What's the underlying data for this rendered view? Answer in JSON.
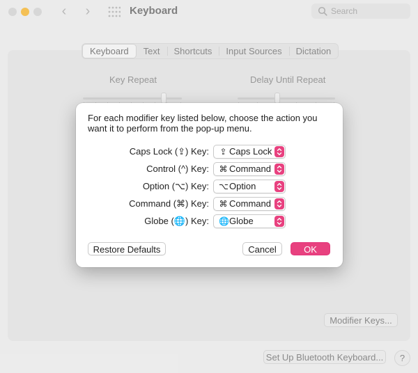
{
  "window": {
    "title": "Keyboard",
    "search_placeholder": "Search"
  },
  "tabs": [
    {
      "label": "Keyboard",
      "selected": true
    },
    {
      "label": "Text",
      "selected": false
    },
    {
      "label": "Shortcuts",
      "selected": false
    },
    {
      "label": "Input Sources",
      "selected": false
    },
    {
      "label": "Dictation",
      "selected": false
    }
  ],
  "sliders": {
    "key_repeat_label": "Key Repeat",
    "delay_label": "Delay Until Repeat"
  },
  "panel": {
    "modifier_keys_button": "Modifier Keys...",
    "bluetooth_button": "Set Up Bluetooth Keyboard...",
    "help_button": "?"
  },
  "dialog": {
    "message": "For each modifier key listed below, choose the action you want it to perform from the pop-up menu.",
    "rows": [
      {
        "label": "Caps Lock (⇪) Key:",
        "glyph": "⇪",
        "value": "Caps Lock"
      },
      {
        "label": "Control (^) Key:",
        "glyph": "⌘",
        "value": "Command"
      },
      {
        "label": "Option (⌥) Key:",
        "glyph": "⌥",
        "value": "Option"
      },
      {
        "label": "Command (⌘) Key:",
        "glyph": "⌘",
        "value": "Command"
      },
      {
        "label": "Globe (🌐) Key:",
        "glyph": "🌐",
        "value": "Globe"
      }
    ],
    "restore_button": "Restore Defaults",
    "cancel_button": "Cancel",
    "ok_button": "OK"
  },
  "colors": {
    "accent": "#e8417f",
    "minimize": "#f6b93b"
  },
  "icons": [
    "chevron-left-icon",
    "chevron-right-icon",
    "grid-icon",
    "search-icon",
    "globe-icon",
    "up-down-arrows-icon"
  ]
}
